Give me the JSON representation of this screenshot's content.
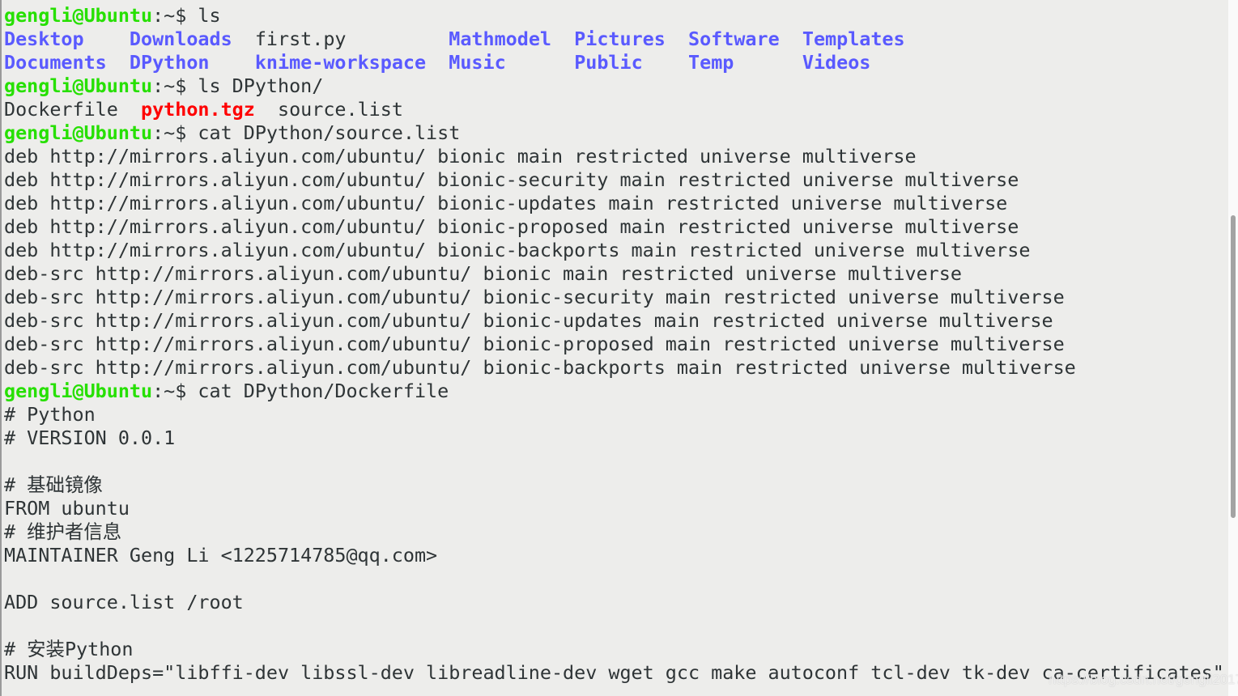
{
  "colors": {
    "background": "#ededeb",
    "text": "#2e3436",
    "prompt": "#26e000",
    "directory": "#5a5aff",
    "archive": "#ff0000"
  },
  "terminal": {
    "lines": [
      [
        {
          "t": "gengli@Ubuntu",
          "c": "prompt-user"
        },
        {
          "t": ":~$ ls",
          "c": "prompt-path"
        }
      ],
      [
        {
          "t": "Desktop",
          "c": "dir"
        },
        {
          "t": "    ",
          "c": "plain"
        },
        {
          "t": "Downloads",
          "c": "dir"
        },
        {
          "t": "  first.py         ",
          "c": "plain"
        },
        {
          "t": "Mathmodel",
          "c": "dir"
        },
        {
          "t": "  ",
          "c": "plain"
        },
        {
          "t": "Pictures",
          "c": "dir"
        },
        {
          "t": "  ",
          "c": "plain"
        },
        {
          "t": "Software",
          "c": "dir"
        },
        {
          "t": "  ",
          "c": "plain"
        },
        {
          "t": "Templates",
          "c": "dir"
        }
      ],
      [
        {
          "t": "Documents",
          "c": "dir"
        },
        {
          "t": "  ",
          "c": "plain"
        },
        {
          "t": "DPython",
          "c": "dir"
        },
        {
          "t": "    ",
          "c": "plain"
        },
        {
          "t": "knime-workspace",
          "c": "dir"
        },
        {
          "t": "  ",
          "c": "plain"
        },
        {
          "t": "Music",
          "c": "dir"
        },
        {
          "t": "      ",
          "c": "plain"
        },
        {
          "t": "Public",
          "c": "dir"
        },
        {
          "t": "    ",
          "c": "plain"
        },
        {
          "t": "Temp",
          "c": "dir"
        },
        {
          "t": "      ",
          "c": "plain"
        },
        {
          "t": "Videos",
          "c": "dir"
        }
      ],
      [
        {
          "t": "gengli@Ubuntu",
          "c": "prompt-user"
        },
        {
          "t": ":~$ ls DPython/",
          "c": "prompt-path"
        }
      ],
      [
        {
          "t": "Dockerfile  ",
          "c": "plain"
        },
        {
          "t": "python.tgz",
          "c": "archive"
        },
        {
          "t": "  source.list",
          "c": "plain"
        }
      ],
      [
        {
          "t": "gengli@Ubuntu",
          "c": "prompt-user"
        },
        {
          "t": ":~$ cat DPython/source.list",
          "c": "prompt-path"
        }
      ],
      [
        {
          "t": "deb http://mirrors.aliyun.com/ubuntu/ bionic main restricted universe multiverse",
          "c": "plain"
        }
      ],
      [
        {
          "t": "deb http://mirrors.aliyun.com/ubuntu/ bionic-security main restricted universe multiverse",
          "c": "plain"
        }
      ],
      [
        {
          "t": "deb http://mirrors.aliyun.com/ubuntu/ bionic-updates main restricted universe multiverse",
          "c": "plain"
        }
      ],
      [
        {
          "t": "deb http://mirrors.aliyun.com/ubuntu/ bionic-proposed main restricted universe multiverse",
          "c": "plain"
        }
      ],
      [
        {
          "t": "deb http://mirrors.aliyun.com/ubuntu/ bionic-backports main restricted universe multiverse",
          "c": "plain"
        }
      ],
      [
        {
          "t": "deb-src http://mirrors.aliyun.com/ubuntu/ bionic main restricted universe multiverse",
          "c": "plain"
        }
      ],
      [
        {
          "t": "deb-src http://mirrors.aliyun.com/ubuntu/ bionic-security main restricted universe multiverse",
          "c": "plain"
        }
      ],
      [
        {
          "t": "deb-src http://mirrors.aliyun.com/ubuntu/ bionic-updates main restricted universe multiverse",
          "c": "plain"
        }
      ],
      [
        {
          "t": "deb-src http://mirrors.aliyun.com/ubuntu/ bionic-proposed main restricted universe multiverse",
          "c": "plain"
        }
      ],
      [
        {
          "t": "deb-src http://mirrors.aliyun.com/ubuntu/ bionic-backports main restricted universe multiverse",
          "c": "plain"
        }
      ],
      [
        {
          "t": "gengli@Ubuntu",
          "c": "prompt-user"
        },
        {
          "t": ":~$ cat DPython/Dockerfile",
          "c": "prompt-path"
        }
      ],
      [
        {
          "t": "# Python",
          "c": "plain"
        }
      ],
      [
        {
          "t": "# VERSION 0.0.1",
          "c": "plain"
        }
      ],
      [],
      [
        {
          "t": "# 基础镜像",
          "c": "plain"
        }
      ],
      [
        {
          "t": "FROM ubuntu",
          "c": "plain"
        }
      ],
      [
        {
          "t": "# 维护者信息",
          "c": "plain"
        }
      ],
      [
        {
          "t": "MAINTAINER Geng Li <1225714785@qq.com>",
          "c": "plain"
        }
      ],
      [],
      [
        {
          "t": "ADD source.list /root",
          "c": "plain"
        }
      ],
      [],
      [
        {
          "t": "# 安装Python",
          "c": "plain"
        }
      ],
      [
        {
          "t": "RUN buildDeps=\"libffi-dev libssl-dev libreadline-dev wget gcc make autoconf tcl-dev tk-dev ca-certificates\"",
          "c": "plain"
        }
      ]
    ]
  },
  "watermark": "https://blog.csdn.net/gengli2017"
}
